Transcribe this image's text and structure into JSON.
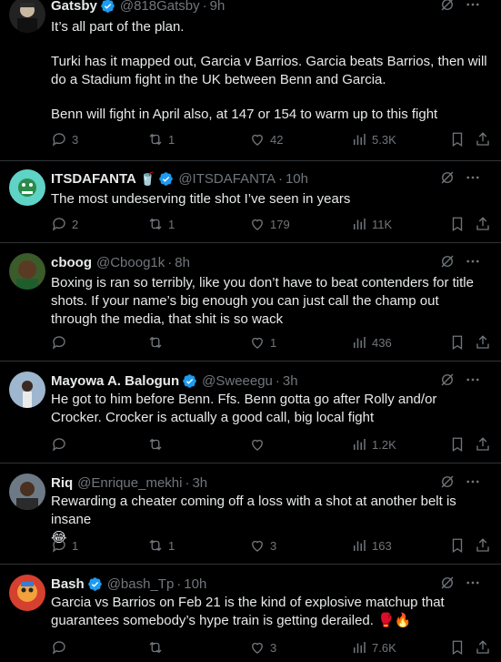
{
  "tweets": [
    {
      "name": "Gatsby",
      "handle": "@818Gatsby",
      "time": "9h",
      "paragraphs": [
        "It’s all part of the plan.",
        "Turki has it mapped out, Garcia v Barrios. Garcia beats Barrios, then will do a Stadium fight in the UK between Benn and Garcia.",
        "Benn will fight in April also, at 147 or 154 to warm up to this fight"
      ],
      "replies": "3",
      "reposts": "1",
      "likes": "42",
      "views": "5.3K"
    },
    {
      "name": "ITSDAFANTA",
      "name_emoji": "🥤",
      "handle": "@ITSDAFANTA",
      "time": "10h",
      "paragraphs": [
        "The most undeserving title shot I’ve seen in years"
      ],
      "replies": "2",
      "reposts": "1",
      "likes": "179",
      "views": "11K"
    },
    {
      "name": "cboog",
      "handle": "@Cboog1k",
      "time": "8h",
      "paragraphs": [
        "Boxing is ran so terribly, like you don’t have to beat contenders for title shots. If your name’s big enough you can just call the champ out through the media, that shit is so wack"
      ],
      "replies": "",
      "reposts": "",
      "likes": "1",
      "views": "436"
    },
    {
      "name": "Mayowa A. Balogun",
      "handle": "@Sweeegu",
      "time": "3h",
      "paragraphs": [
        "He got to him before Benn. Ffs. Benn gotta go after Rolly and/or Crocker. Crocker is actually a good call, big local fight"
      ],
      "replies": "",
      "reposts": "",
      "likes": "",
      "views": "1.2K"
    },
    {
      "name": "Riq",
      "handle": "@Enrique_mekhi",
      "time": "3h",
      "paragraphs": [
        "Rewarding a cheater coming off a loss with a shot at another belt is insane",
        "😂"
      ],
      "replies": "1",
      "reposts": "1",
      "likes": "3",
      "views": "163"
    },
    {
      "name": "Bash",
      "handle": "@bash_Tp",
      "time": "10h",
      "paragraphs": [
        "Garcia vs Barrios on Feb 21 is the kind of explosive matchup that guarantees somebody’s hype train is getting derailed. 🥊🔥"
      ],
      "replies": "",
      "reposts": "",
      "likes": "3",
      "views": "7.6K"
    }
  ],
  "colors": {
    "verified": "#1d9bf0",
    "muted": "#71767b",
    "text": "#e7e9ea",
    "border": "#2f3336"
  }
}
